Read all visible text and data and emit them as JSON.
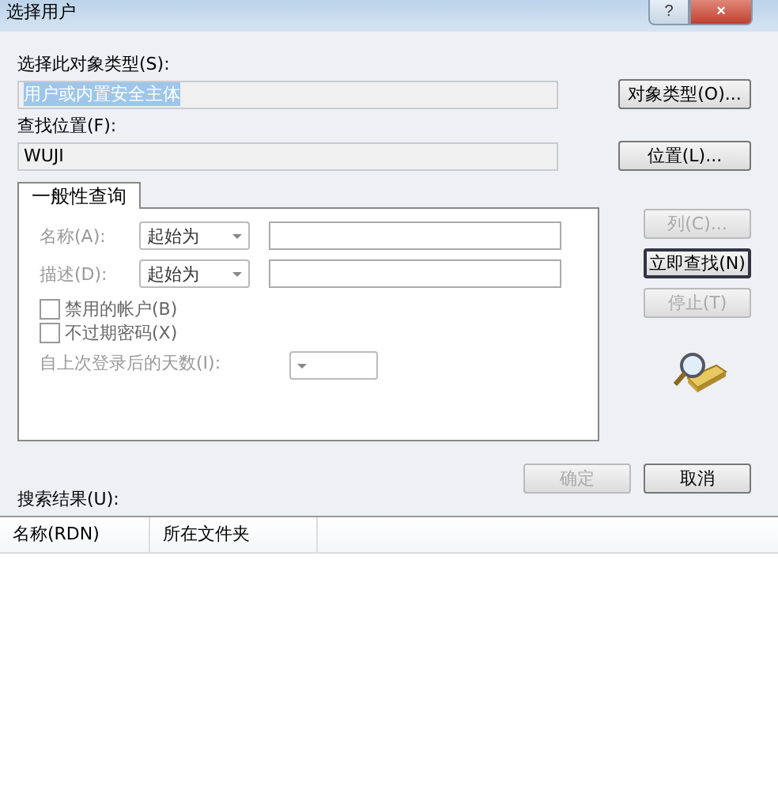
{
  "window": {
    "title": "选择用户",
    "buttons": [
      "?",
      "×"
    ]
  },
  "object_type": {
    "label": "选择此对象类型(S):",
    "value": "用户或内置安全主体",
    "value_selected": true,
    "button": "对象类型(O)..."
  },
  "location": {
    "label": "查找位置(F):",
    "value": "WUJI",
    "button": "位置(L)..."
  },
  "tabs": [
    {
      "label": "一般性查询",
      "selected": true
    }
  ],
  "query": {
    "rows": [
      {
        "label": "名称(A):",
        "mode": "起始为",
        "value": ""
      },
      {
        "label": "描述(D):",
        "mode": "起始为",
        "value": ""
      }
    ],
    "checkboxes": [
      {
        "label": "禁用的帐户(B)",
        "checked": false
      },
      {
        "label": "不过期密码(X)",
        "checked": false
      }
    ],
    "days": {
      "label": "自上次登录后的天数(I):"
    }
  },
  "side_buttons": [
    {
      "label": "列(C)...",
      "disabled": true
    },
    {
      "label": "立即查找(N)",
      "disabled": false
    },
    {
      "label": "停止(T)",
      "disabled": true
    }
  ],
  "dialog_buttons": [
    {
      "label": "确定",
      "disabled": true
    },
    {
      "label": "取消",
      "disabled": false
    }
  ],
  "results": {
    "label": "搜索结果(U):",
    "columns": [
      "名称(RDN)",
      "所在文件夹"
    ]
  }
}
